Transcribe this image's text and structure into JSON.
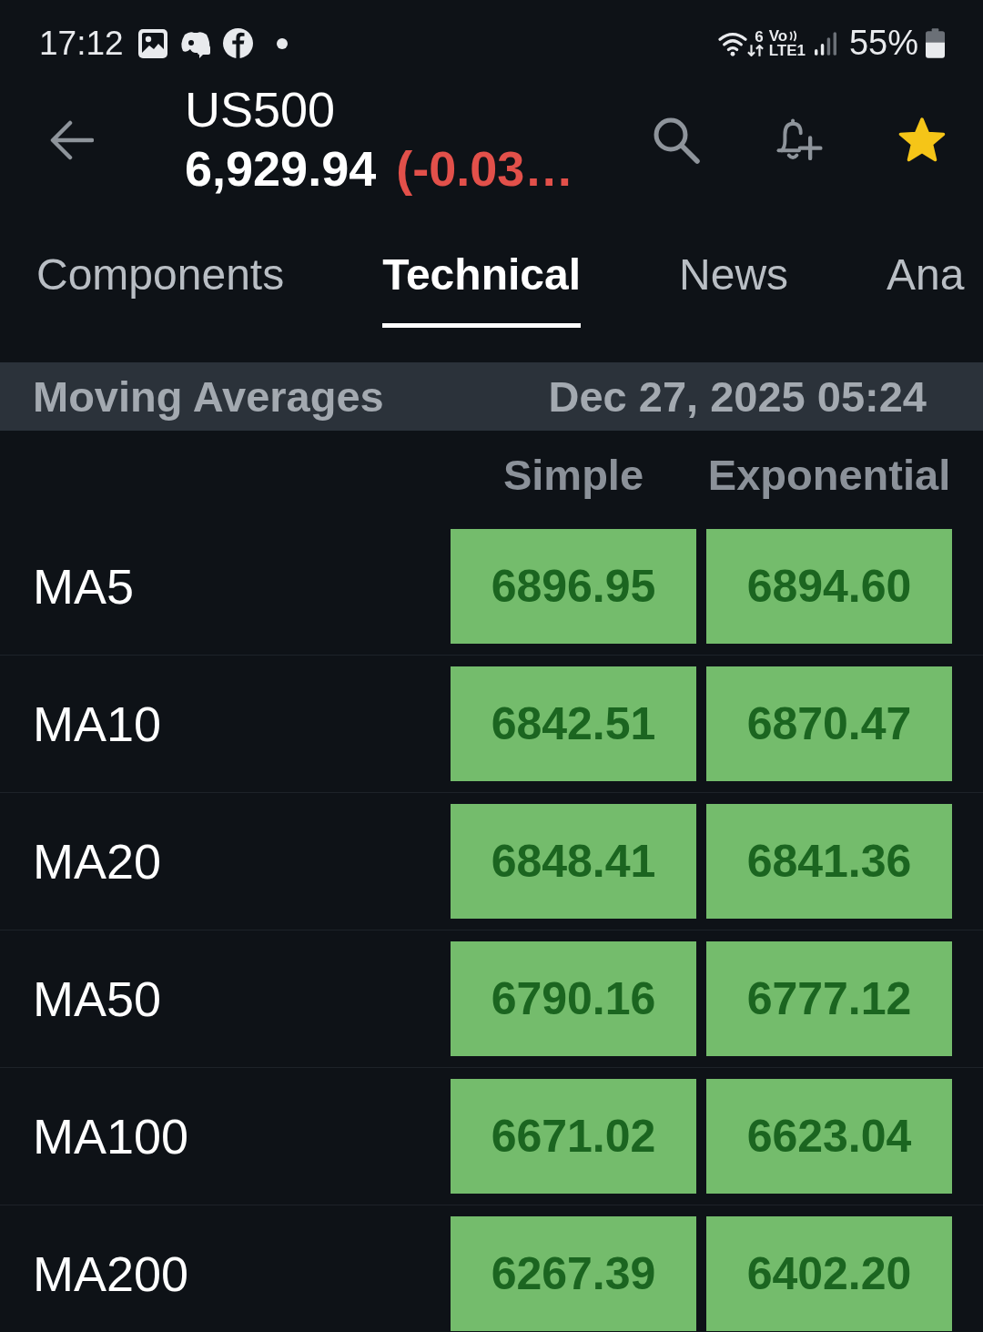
{
  "status_bar": {
    "time": "17:12",
    "wifi_badge": "6",
    "volte_top": "Vo",
    "volte_bottom": "LTE1",
    "battery": "55%"
  },
  "header": {
    "symbol": "US500",
    "price": "6,929.94",
    "change": "(-0.03…",
    "favorite": true
  },
  "tabs": [
    {
      "label": "Components",
      "selected": false
    },
    {
      "label": "Technical",
      "selected": true
    },
    {
      "label": "News",
      "selected": false
    },
    {
      "label": "Ana",
      "selected": false
    }
  ],
  "section": {
    "title": "Moving Averages",
    "timestamp": "Dec 27, 2025 05:24"
  },
  "columns": [
    "Simple",
    "Exponential"
  ],
  "rows": [
    {
      "label": "MA5",
      "cells": [
        {
          "value": "6896.95",
          "color": "#74bc6c"
        },
        {
          "value": "6894.60",
          "color": "#74bc6c"
        }
      ]
    },
    {
      "label": "MA10",
      "cells": [
        {
          "value": "6842.51",
          "color": "#74bc6c"
        },
        {
          "value": "6870.47",
          "color": "#74bc6c"
        }
      ]
    },
    {
      "label": "MA20",
      "cells": [
        {
          "value": "6848.41",
          "color": "#74bc6c"
        },
        {
          "value": "6841.36",
          "color": "#74bc6c"
        }
      ]
    },
    {
      "label": "MA50",
      "cells": [
        {
          "value": "6790.16",
          "color": "#74bc6c"
        },
        {
          "value": "6777.12",
          "color": "#74bc6c"
        }
      ]
    },
    {
      "label": "MA100",
      "cells": [
        {
          "value": "6671.02",
          "color": "#74bc6c"
        },
        {
          "value": "6623.04",
          "color": "#74bc6c"
        }
      ]
    },
    {
      "label": "MA200",
      "cells": [
        {
          "value": "6267.39",
          "color": "#74bc6c"
        },
        {
          "value": "6402.20",
          "color": "#74bc6c"
        }
      ]
    }
  ]
}
